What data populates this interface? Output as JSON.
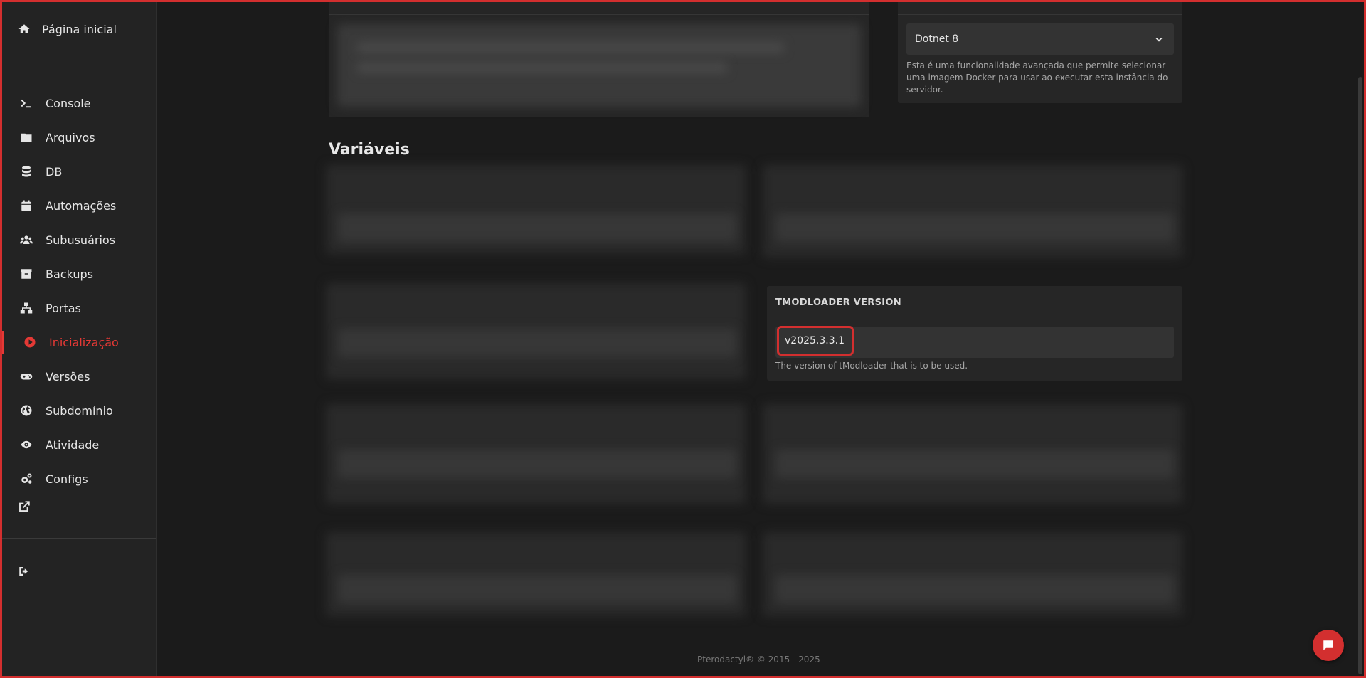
{
  "sidebar": {
    "home_label": "Página inicial",
    "items": [
      {
        "label": "Console",
        "icon": "terminal-icon"
      },
      {
        "label": "Arquivos",
        "icon": "folder-icon"
      },
      {
        "label": "DB",
        "icon": "database-icon"
      },
      {
        "label": "Automações",
        "icon": "calendar-icon"
      },
      {
        "label": "Subusuários",
        "icon": "users-icon"
      },
      {
        "label": "Backups",
        "icon": "archive-icon"
      },
      {
        "label": "Portas",
        "icon": "network-icon"
      },
      {
        "label": "Inicialização",
        "icon": "play-circle-icon",
        "active": true
      },
      {
        "label": "Versões",
        "icon": "gamepad-icon"
      },
      {
        "label": "Subdomínio",
        "icon": "globe-icon"
      },
      {
        "label": "Atividade",
        "icon": "eye-icon"
      },
      {
        "label": "Configs",
        "icon": "cogs-icon"
      }
    ]
  },
  "docker": {
    "selected": "Dotnet 8",
    "description": "Esta é uma funcionalidade avançada que permite selecionar uma imagem Docker para usar ao executar esta instância do servidor."
  },
  "variables": {
    "title": "Variáveis",
    "tmodloader": {
      "label": "TMODLOADER VERSION",
      "value": "v2025.3.3.1",
      "description": "The version of tModloader that is to be used."
    }
  },
  "footer": "Pterodactyl® © 2015 - 2025",
  "colors": {
    "accent": "#e53935",
    "background": "#1b1b1b",
    "panel": "#262626"
  }
}
